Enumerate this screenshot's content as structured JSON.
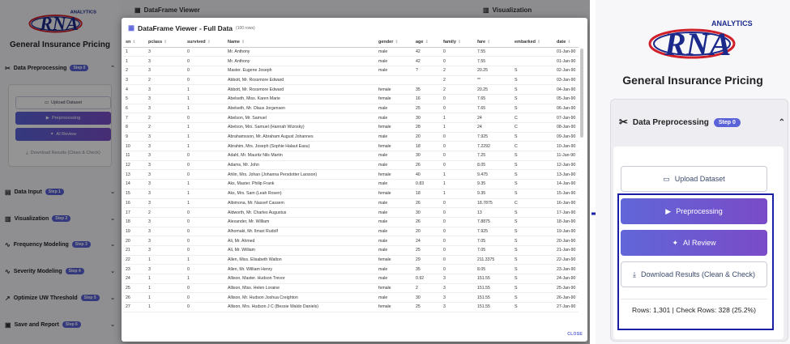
{
  "app": {
    "logo_text": "RNA",
    "logo_sub": "ANALYTICS",
    "title": "General Insurance Pricing",
    "sections": [
      {
        "label": "Data Preprocessing",
        "badge": "Step 0"
      },
      {
        "label": "Data Input",
        "badge": "Step 1"
      },
      {
        "label": "Visualization",
        "badge": "Step 2"
      },
      {
        "label": "Frequency Modeling",
        "badge": "Step 3"
      },
      {
        "label": "Severity Modeling",
        "badge": "Step 4"
      },
      {
        "label": "Optimize UW Threshold",
        "badge": "Step 5"
      },
      {
        "label": "Save and Report",
        "badge": "Step 6"
      }
    ],
    "buttons": {
      "upload": "Upload Dataset",
      "preprocess": "Preprocessing",
      "ai_review": "AI Review",
      "download": "Download Results (Clean & Check)"
    },
    "right_headers": {
      "viewer": "DataFrame Viewer",
      "visualization": "Visualization"
    }
  },
  "modal": {
    "title": "DataFrame Viewer - Full Data",
    "rows_note": "(100 rows)",
    "close": "CLOSE",
    "columns": [
      "sn",
      "pclass",
      "survived",
      "Name",
      "gender",
      "age",
      "family",
      "fare",
      "embarked",
      "date"
    ],
    "rows": [
      [
        "1",
        "3",
        "0",
        "Mr. Anthony",
        "male",
        "42",
        "0",
        "7.55",
        "",
        "01-Jan-90"
      ],
      [
        "1",
        "3",
        "0",
        "Mr. Anthony",
        "male",
        "42",
        "0",
        "7.55",
        "",
        "01-Jan-90"
      ],
      [
        "2",
        "3",
        "0",
        "Master. Eugene Joseph",
        "male",
        "?",
        "2",
        "20.25",
        "S",
        "02-Jan-90"
      ],
      [
        "3",
        "2",
        "0",
        "Abbott, Mr. Rossmore Edward",
        "",
        "",
        "2",
        "**",
        "S",
        "03-Jan-90"
      ],
      [
        "4",
        "3",
        "1",
        "Abbott, Mr. Rossmore Edward",
        "female",
        "35",
        "2",
        "20.25",
        "S",
        "04-Jan-90"
      ],
      [
        "5",
        "3",
        "1",
        "Abelseth, Miss. Karen Marie",
        "female",
        "16",
        "0",
        "7.65",
        "S",
        "05-Jan-90"
      ],
      [
        "6",
        "3",
        "1",
        "Abelseth, Mr. Olaus Jorgensen",
        "male",
        "25",
        "0",
        "7.65",
        "S",
        "06-Jan-90"
      ],
      [
        "7",
        "2",
        "0",
        "Abelson, Mr. Samuel",
        "male",
        "30",
        "1",
        "24",
        "C",
        "07-Jan-90"
      ],
      [
        "8",
        "2",
        "1",
        "Abelson, Mrs. Samuel (Hannah Wizosky)",
        "female",
        "28",
        "1",
        "24",
        "C",
        "08-Jan-90"
      ],
      [
        "9",
        "3",
        "1",
        "Abrahamsson, Mr. Abraham August Johannes",
        "male",
        "20",
        "0",
        "7.925",
        "S",
        "09-Jan-90"
      ],
      [
        "10",
        "3",
        "1",
        "Abrahim, Mrs. Joseph (Sophie Halaut Easu)",
        "female",
        "18",
        "0",
        "7.2292",
        "C",
        "10-Jan-90"
      ],
      [
        "11",
        "3",
        "0",
        "Adahl, Mr. Mauritz Nils Martin",
        "male",
        "30",
        "0",
        "7.25",
        "S",
        "11-Jan-90"
      ],
      [
        "12",
        "3",
        "0",
        "Adams, Mr. John",
        "male",
        "26",
        "0",
        "8.05",
        "S",
        "12-Jan-90"
      ],
      [
        "13",
        "3",
        "0",
        "Ahlin, Mrs. Johan (Johanna Persdotter Larsson)",
        "female",
        "40",
        "1",
        "9.475",
        "S",
        "13-Jan-90"
      ],
      [
        "14",
        "3",
        "1",
        "Aks, Master. Philip Frank",
        "male",
        "0.83",
        "1",
        "9.35",
        "S",
        "14-Jan-90"
      ],
      [
        "15",
        "3",
        "1",
        "Aks, Mrs. Sam (Leah Rosen)",
        "female",
        "18",
        "1",
        "9.35",
        "S",
        "15-Jan-90"
      ],
      [
        "16",
        "3",
        "1",
        "Albimona, Mr. Nassef Cassem",
        "male",
        "26",
        "0",
        "18.7875",
        "C",
        "16-Jan-90"
      ],
      [
        "17",
        "2",
        "0",
        "Aldworth, Mr. Charles Augustus",
        "male",
        "30",
        "0",
        "13",
        "S",
        "17-Jan-90"
      ],
      [
        "18",
        "3",
        "0",
        "Alexander, Mr. William",
        "male",
        "26",
        "0",
        "7.8875",
        "S",
        "18-Jan-90"
      ],
      [
        "19",
        "3",
        "0",
        "Alhomaki, Mr. Ilmari Rudolf",
        "male",
        "20",
        "0",
        "7.925",
        "S",
        "19-Jan-90"
      ],
      [
        "20",
        "3",
        "0",
        "Ali, Mr. Ahmed",
        "male",
        "24",
        "0",
        "7.05",
        "S",
        "20-Jan-90"
      ],
      [
        "21",
        "3",
        "0",
        "Ali, Mr. William",
        "male",
        "25",
        "0",
        "7.05",
        "S",
        "21-Jan-90"
      ],
      [
        "22",
        "1",
        "1",
        "Allen, Miss. Elisabeth Walton",
        "female",
        "29",
        "0",
        "211.3375",
        "S",
        "22-Jan-90"
      ],
      [
        "23",
        "3",
        "0",
        "Allen, Mr. William Henry",
        "male",
        "35",
        "0",
        "8.05",
        "S",
        "23-Jan-90"
      ],
      [
        "24",
        "1",
        "1",
        "Allison, Master. Hudson Trevor",
        "male",
        "0.92",
        "3",
        "151.55",
        "S",
        "24-Jan-90"
      ],
      [
        "25",
        "1",
        "0",
        "Allison, Miss. Helen Loraine",
        "female",
        "2",
        "3",
        "151.55",
        "S",
        "25-Jan-90"
      ],
      [
        "26",
        "1",
        "0",
        "Allison, Mr. Hudson Joshua Creighton",
        "male",
        "30",
        "3",
        "151.55",
        "S",
        "26-Jan-90"
      ],
      [
        "27",
        "1",
        "0",
        "Allison, Mrs. Hudson J C (Bessie Waldo Daniels)",
        "female",
        "25",
        "3",
        "151.55",
        "S",
        "27-Jan-90"
      ]
    ]
  },
  "zoom": {
    "logo_text": "RNA",
    "logo_sub": "ANALYTICS",
    "title": "General Insurance Pricing",
    "section_label": "Data Preprocessing",
    "section_badge": "Step 0",
    "upload": "Upload Dataset",
    "preprocess": "Preprocessing",
    "ai_review": "AI Review",
    "download": "Download Results (Clean & Check)",
    "stats": "Rows: 1,301  |  Check Rows: 328  (25.2%)"
  },
  "colors": {
    "accent": "#5b63d9",
    "accent2": "#7a4bc8",
    "highlight": "#1a1fa6",
    "logo_red": "#d0202a",
    "logo_navy": "#1b2a8a"
  }
}
